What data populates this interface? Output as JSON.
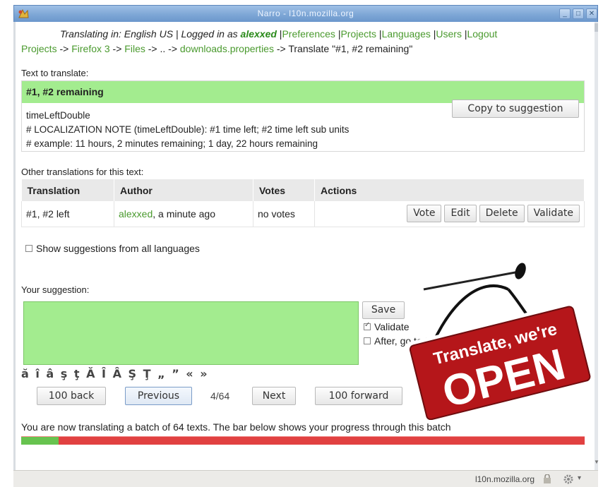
{
  "window": {
    "title": "Narro - l10n.mozilla.org"
  },
  "header": {
    "translating_prefix": "Translating in: ",
    "language": "English US",
    "logged_prefix": " | Logged in as ",
    "user": "alexxed",
    "nav": [
      "Preferences",
      "Projects",
      "Languages",
      "Users",
      "Logout"
    ]
  },
  "breadcrumb": {
    "items": [
      "Projects",
      "Firefox 3",
      "Files",
      "..",
      "downloads.properties"
    ],
    "current": "Translate \"#1, #2 remaining\""
  },
  "source": {
    "label": "Text to translate:",
    "text": "#1, #2 remaining",
    "notes": [
      "timeLeftDouble",
      "# LOCALIZATION NOTE (timeLeftDouble): #1 time left; #2 time left sub units",
      "# example: 11 hours, 2 minutes remaining; 1 day, 22 hours remaining"
    ],
    "copy_button": "Copy to suggestion"
  },
  "others": {
    "label": "Other translations for this text:",
    "columns": [
      "Translation",
      "Author",
      "Votes",
      "Actions"
    ],
    "rows": [
      {
        "translation": "#1, #2 left",
        "author": "alexxed",
        "time": ", a minute ago",
        "votes": "no votes"
      }
    ],
    "actions": [
      "Vote",
      "Edit",
      "Delete",
      "Validate"
    ]
  },
  "show_all_languages": {
    "label": "Show suggestions from all languages",
    "checked": false
  },
  "suggestion": {
    "label": "Your suggestion:",
    "value": "",
    "save_button": "Save",
    "validate": {
      "label": "Validate",
      "checked": true
    },
    "after": {
      "label": "After, go to t",
      "checked": false
    },
    "special_chars": "ă î â ş ţ Ă Î Â Ş Ţ „ ” « »"
  },
  "navigation": {
    "back100": "100 back",
    "previous": "Previous",
    "position": "4/64",
    "next": "Next",
    "forward100": "100 forward"
  },
  "progress": {
    "text": "You are now translating a batch of 64 texts. The bar below shows your progress through this batch",
    "fraction": 0.0664,
    "done_color": "#67c34f",
    "remaining_color": "#e14141"
  },
  "badge": {
    "line1": "Translate, we're",
    "line2": "OPEN",
    "color": "#b5161a"
  },
  "status": {
    "host": "l10n.mozilla.org"
  }
}
